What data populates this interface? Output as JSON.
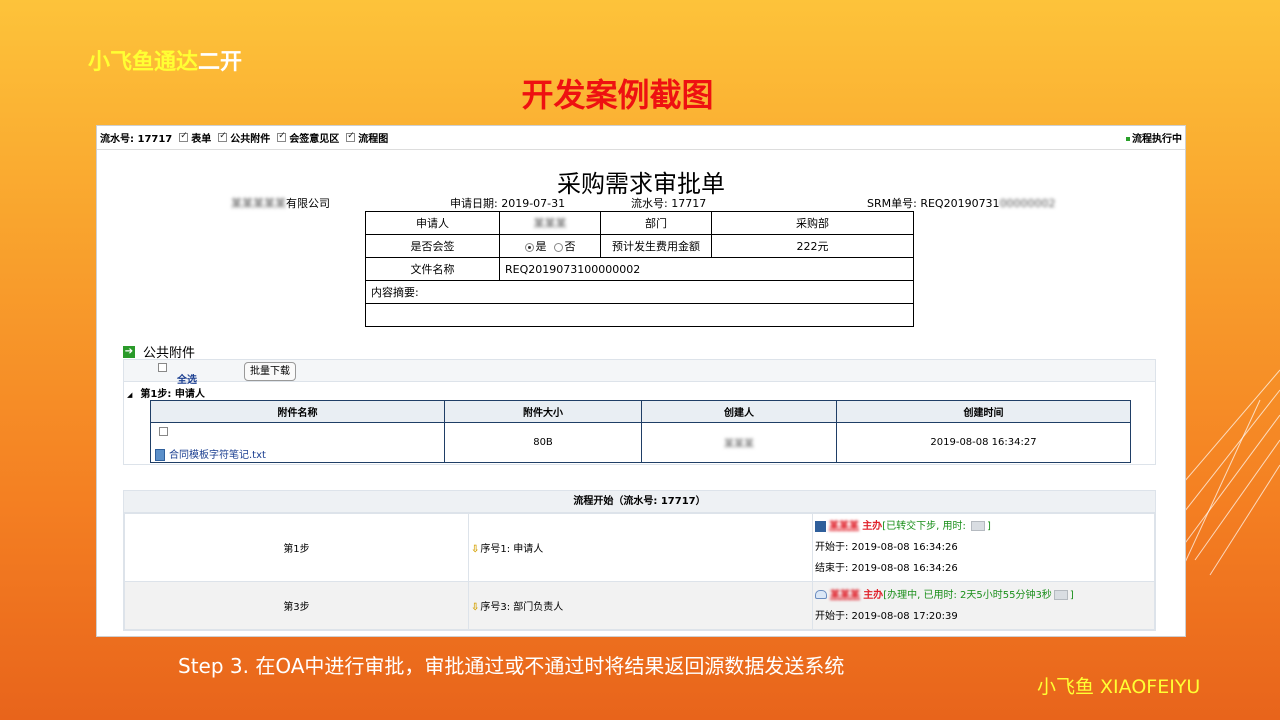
{
  "slide": {
    "brand_part1": "小飞鱼通达",
    "brand_part2": "二开",
    "title": "开发案例截图",
    "caption": "Step 3. 在OA中进行审批，审批通过或不通过时将结果返回源数据发送系统",
    "brand_bottom": "小飞鱼  XIAOFEIYU"
  },
  "toolbar": {
    "serial_label": "流水号: 17717",
    "items": [
      "表单",
      "公共附件",
      "会签意见区",
      "流程图"
    ],
    "status": "流程执行中"
  },
  "form": {
    "title": "采购需求审批单",
    "company": "有限公司",
    "company_blur": "某某某某某",
    "apply_date": "申请日期: 2019-07-31",
    "serial": "流水号: 17717",
    "srm_prefix": "SRM单号: REQ20190731",
    "srm_blur": "00000002",
    "applicant_label": "申请人",
    "applicant_value": "某某某",
    "dept_label": "部门",
    "dept_value": "采购部",
    "countersign_label": "是否会签",
    "yes": "是",
    "no": "否",
    "cost_label": "预计发生费用金额",
    "cost_value": "222元",
    "file_label": "文件名称",
    "file_value": "REQ2019073100000002",
    "summary_label": "内容摘要:"
  },
  "attachments": {
    "heading": "公共附件",
    "select_all": "全选",
    "bulk_download": "批量下载",
    "step_label": "第1步: 申请人",
    "columns": [
      "附件名称",
      "附件大小",
      "创建人",
      "创建时间"
    ],
    "rows": [
      {
        "name": "合同模板字符笔记.txt",
        "size": "80B",
        "creator": "某某某",
        "created": "2019-08-08 16:34:27"
      }
    ]
  },
  "flow": {
    "heading": "流程开始（流水号: 17717）",
    "rows": [
      {
        "step": "第1步",
        "seq": "序号1: 申请人",
        "handler": "某某某",
        "role": "主办",
        "state": "[已转交下步, 用时: ",
        "state_end": "]",
        "start": "开始于: 2019-08-08 16:34:26",
        "end": "结束于: 2019-08-08 16:34:26"
      },
      {
        "step": "第3步",
        "seq": "序号3: 部门负责人",
        "handler": "某某某",
        "role": "主办",
        "state": "[办理中, 已用时: 2天5小时55分钟3秒",
        "state_end": "]",
        "start": "开始于: 2019-08-08 17:20:39"
      }
    ]
  },
  "colors": {
    "background_top": "#fdc33a",
    "background_bottom": "#e8641b",
    "title_red": "#ee1111",
    "brand_yellow": "#ffff33",
    "link_blue": "#1b3f91",
    "status_green": "#1a8f1a"
  }
}
